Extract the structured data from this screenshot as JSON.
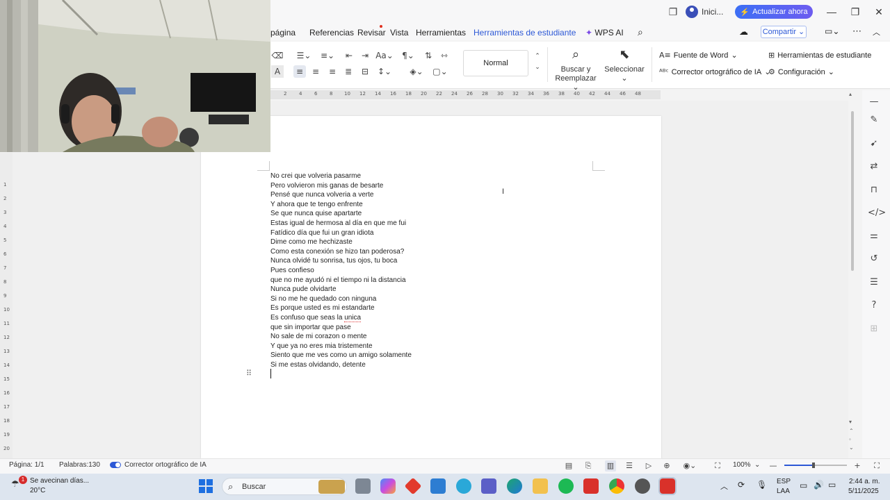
{
  "titlebar": {
    "signin_label": "Inici...",
    "update_label": "Actualizar ahora"
  },
  "menu": {
    "tabs": [
      "página",
      "Referencias",
      "Revisar",
      "Vista",
      "Herramientas",
      "Herramientas de estudiante",
      "WPS AI"
    ],
    "active_tab": "Herramientas de estudiante",
    "share_label": "Compartir"
  },
  "ribbon": {
    "style_name": "Normal",
    "find_replace_line1": "Buscar y",
    "find_replace_line2": "Reemplazar",
    "select_label": "Seleccionar",
    "word_font_label": "Fuente de Word",
    "ai_spellcheck_label": "Corrector ortográfico de IA",
    "student_tools_label": "Herramientas de estudiante",
    "settings_label": "Configuración"
  },
  "ruler": {
    "h_ticks": [
      "2",
      "4",
      "6",
      "8",
      "10",
      "12",
      "14",
      "16",
      "18",
      "20",
      "22",
      "24",
      "26",
      "28",
      "30",
      "32",
      "34",
      "36",
      "38",
      "40",
      "42",
      "44",
      "46",
      "48"
    ],
    "v_ticks": [
      "1",
      "2",
      "3",
      "4",
      "5",
      "6",
      "7",
      "8",
      "9",
      "10",
      "11",
      "12",
      "13",
      "14",
      "15",
      "16",
      "17",
      "18",
      "19",
      "20"
    ]
  },
  "document": {
    "lines": [
      "No crei que volveria pasarme",
      "Pero volvieron mis ganas de besarte",
      "Pensé que nunca volveria a verte",
      "Y ahora que te tengo enfrente",
      "Se que nunca quise apartarte",
      "Estas igual de hermosa al día en que me fui",
      "Fatídico día que fui un gran idiota",
      "Dime como me hechizaste",
      "Como esta conexión se hizo tan poderosa?",
      "Nunca olvidé tu sonrisa, tus ojos, tu boca",
      "Pues confieso",
      "que no me ayudó ni el tiempo ni la distancia",
      "Nunca pude olvidarte",
      "Si no me he quedado con ninguna",
      "Es porque usted es mi estandarte",
      "Es confuso que seas la ",
      "que sin importar que pase",
      "No sale de mi corazon o mente",
      "Y que ya no eres mia tristemente",
      "Siento que me ves como un amigo solamente",
      "Si me estas olvidando, detente"
    ],
    "misspelled_word": "unica"
  },
  "status": {
    "page": "Página: 1/1",
    "words": "Palabras:130",
    "ai_spellcheck": "Corrector ortográfico de IA",
    "zoom": "100%",
    "zoom_level": 0.47
  },
  "taskbar": {
    "weather_title": "Se avecinan días...",
    "weather_temp": "20°C",
    "notification_count": "1",
    "search_placeholder": "Buscar",
    "lang_line1": "ESP",
    "lang_line2": "LAA",
    "time": "2:44 a. m.",
    "date": "5/11/2025"
  },
  "colors": {
    "accent": "#2c58d6",
    "update_gradient_start": "#3c6ff5",
    "update_gradient_end": "#6d5cf0"
  }
}
